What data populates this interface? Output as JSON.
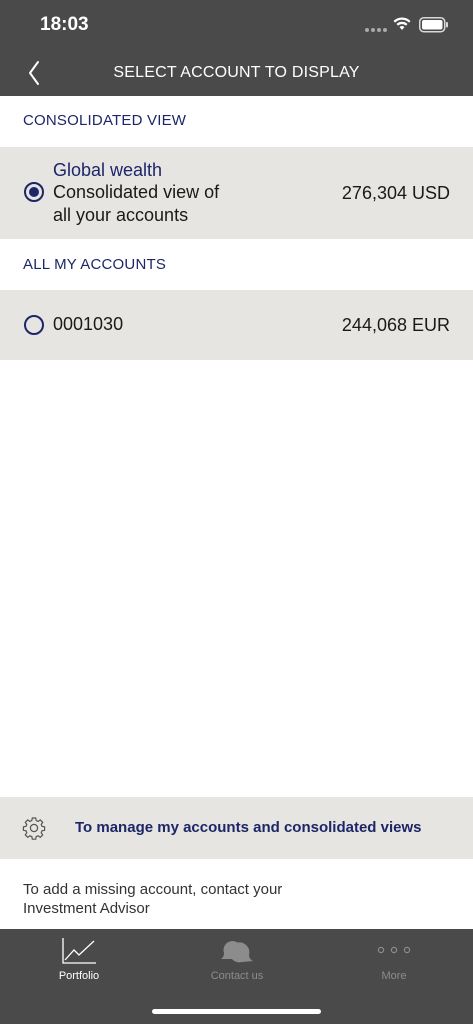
{
  "status_bar": {
    "time": "18:03"
  },
  "nav": {
    "title": "SELECT ACCOUNT TO DISPLAY",
    "back_icon": "chevron-left-icon"
  },
  "consolidated_section": {
    "header": "CONSOLIDATED VIEW",
    "item": {
      "title": "Global wealth",
      "description_line1": "Consolidated view of",
      "description_line2": "all your accounts",
      "amount": "276,304 USD",
      "selected": true
    }
  },
  "accounts_section": {
    "header": "ALL MY ACCOUNTS",
    "items": [
      {
        "number": "0001030",
        "amount": "244,068 EUR",
        "selected": false
      }
    ]
  },
  "manage": {
    "label": "To manage my accounts and consolidated views",
    "icon": "gear-icon"
  },
  "help_text": {
    "line1": "To add a missing account, contact your",
    "line2": "Investment Advisor"
  },
  "tabbar": {
    "tabs": [
      {
        "label": "Portfolio",
        "icon": "chart-line-icon",
        "active": true
      },
      {
        "label": "Contact us",
        "icon": "chat-bubbles-icon",
        "active": false
      },
      {
        "label": "More",
        "icon": "more-dots-icon",
        "active": false
      }
    ]
  },
  "colors": {
    "header_bg": "#4a4a4a",
    "accent_navy": "#1c2668",
    "row_bg": "#e6e5e1",
    "inactive_tab": "#8c8c8c"
  }
}
